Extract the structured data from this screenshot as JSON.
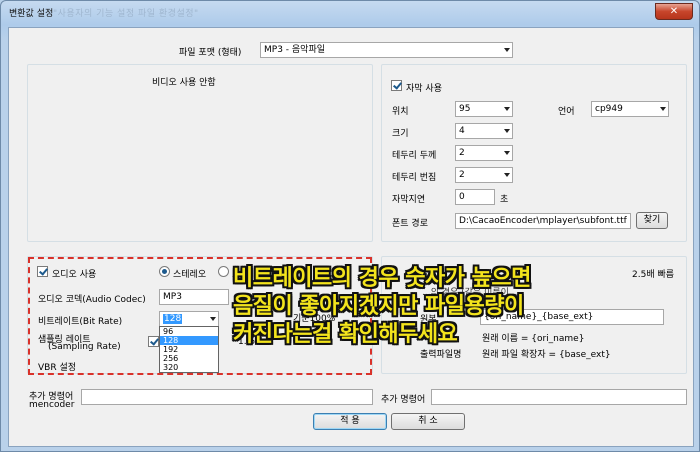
{
  "window": {
    "title": "변환값 설정",
    "title_blur": "\"사용자의 기능 설정 파일 환경설정\"",
    "close_glyph": "✕"
  },
  "file_format": {
    "label": "파일 포맷 (형태)",
    "value": "MP3 - 음악파일"
  },
  "video": {
    "disabled_text": "비디오 사용 안함"
  },
  "subtitle": {
    "use_label": "자막 사용",
    "use_checked": true,
    "position_label": "위치",
    "position_value": "95",
    "language_label": "언어",
    "language_value": "cp949",
    "size_label": "크기",
    "size_value": "4",
    "border_width_label": "테두리 두께",
    "border_width_value": "2",
    "border_blur_label": "테두리 번짐",
    "border_blur_value": "2",
    "delay_label": "자막지연",
    "delay_value": "0",
    "delay_unit": "초",
    "font_path_label": "폰트 경로",
    "font_path_value": "D:\\CacaoEncoder\\mplayer\\subfont.ttf",
    "browse_button": "찾기"
  },
  "audio": {
    "use_label": "오디오 사용",
    "use_checked": true,
    "stereo_label": "스테레오",
    "mono_partial": "모",
    "codec_label": "오디오 코덱(Audio Codec)",
    "codec_value": "MP3",
    "bitrate_label": "비트레이트(Bit Rate)",
    "bitrate_value": "128",
    "bitrate_options": [
      "96",
      "128",
      "192",
      "256",
      "320"
    ],
    "bitrate_selected_index": 1,
    "sampling_label_line1": "샘플링 레이트",
    "sampling_label_line2": "(Sampling Rate)",
    "sampling_checked": true,
    "vbr_label": "VBR 설정",
    "partial_text_1": "기준100%",
    "partial_text_2": "1..5%"
  },
  "right_lower": {
    "partial_speed": "2.5배 빠름",
    "partial_row1": "...의 경우 (같은 이름이...",
    "name_field_value": "{ori_name}_{base_ext}",
    "orig_name_hint": "원래 이름 = {ori_name}",
    "orig_ext_hint": "원래 파일 확장자 = {base_ext}",
    "partial_label_a": "원본",
    "partial_label_b": "출력파일명"
  },
  "extra": {
    "left_label_line1": "추가 명령어",
    "left_label_line2": "mencoder",
    "left_value": "",
    "right_label": "추가 명령어",
    "right_value": ""
  },
  "buttons": {
    "apply": "적 용",
    "cancel": "취 소"
  },
  "annotation": {
    "line1": "비트레이트의 경우 숫자가 높으면",
    "line2": "음질이 좋아지겠지만 파일용량이",
    "line3": "커진다는걸 확인해두세요"
  },
  "colors": {
    "annotation_text": "#f3e41c",
    "annotation_box": "#d9322a",
    "selection": "#3399ff"
  }
}
